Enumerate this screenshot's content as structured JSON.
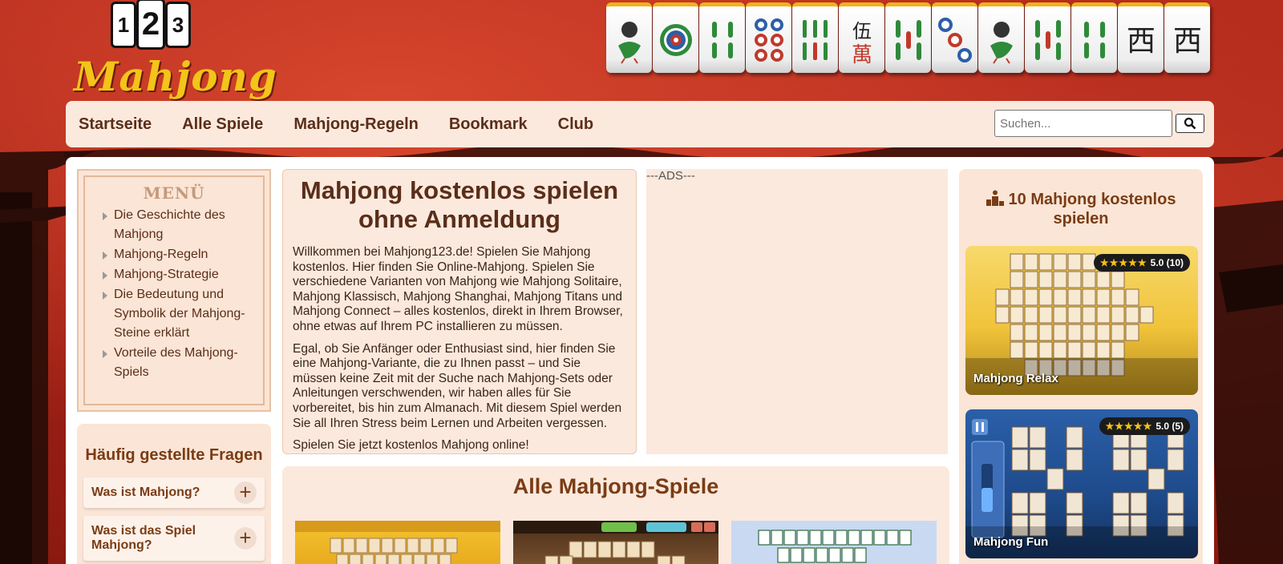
{
  "brand": {
    "logo_digits": [
      "1",
      "2",
      "3"
    ],
    "logo_text": "Mahjong"
  },
  "nav": {
    "items": [
      "Startseite",
      "Alle Spiele",
      "Mahjong-Regeln",
      "Bookmark",
      "Club"
    ],
    "search_placeholder": "Suchen..."
  },
  "menu": {
    "title": "MENÜ",
    "items": [
      "Die Geschichte des Mahjong",
      "Mahjong-Regeln",
      "Mahjong-Strategie",
      "Die Bedeutung und Symbolik der Mahjong-Steine erklärt",
      "Vorteile des Mahjong-Spiels"
    ]
  },
  "faq": {
    "title": "Häufig gestellte Fragen",
    "items": [
      "Was ist Mahjong?",
      "Was ist das Spiel Mahjong?"
    ]
  },
  "intro": {
    "title": "Mahjong kostenlos spielen ohne Anmeldung",
    "p1": "Willkommen bei Mahjong123.de! Spielen Sie Mahjong kostenlos. Hier finden Sie Online-Mahjong. Spielen Sie verschiedene Varianten von Mahjong wie Mahjong Solitaire, Mahjong Klassisch, Mahjong Shanghai, Mahjong Titans und Mahjong Connect – alles kostenlos, direkt in Ihrem Browser, ohne etwas auf Ihrem PC installieren zu müssen.",
    "p2": "Egal, ob Sie Anfänger oder Enthusiast sind, hier finden Sie eine Mahjong-Variante, die zu Ihnen passt – und Sie müssen keine Zeit mit der Suche nach Mahjong-Sets oder Anleitungen verschwenden, wir haben alles für Sie vorbereitet, bis hin zum Almanach. Mit diesem Spiel werden Sie all Ihren Stress beim Lernen und Arbeiten vergessen.",
    "p3": "Spielen Sie jetzt kostenlos Mahjong online!"
  },
  "ads": {
    "label": "---ADS---"
  },
  "all_games": {
    "title": "Alle Mahjong-Spiele"
  },
  "sidebar": {
    "title": "10 Mahjong kostenlos spielen",
    "cards": [
      {
        "name": "Mahjong Relax",
        "stars": "★★★★★",
        "rating": "5.0 (10)"
      },
      {
        "name": "Mahjong Fun",
        "stars": "★★★★★",
        "rating": "5.0 (5)"
      }
    ]
  },
  "colors": {
    "accent": "#5a2e1a",
    "nav_bg": "#fce9dd",
    "logo_yellow": "#f3c419"
  }
}
